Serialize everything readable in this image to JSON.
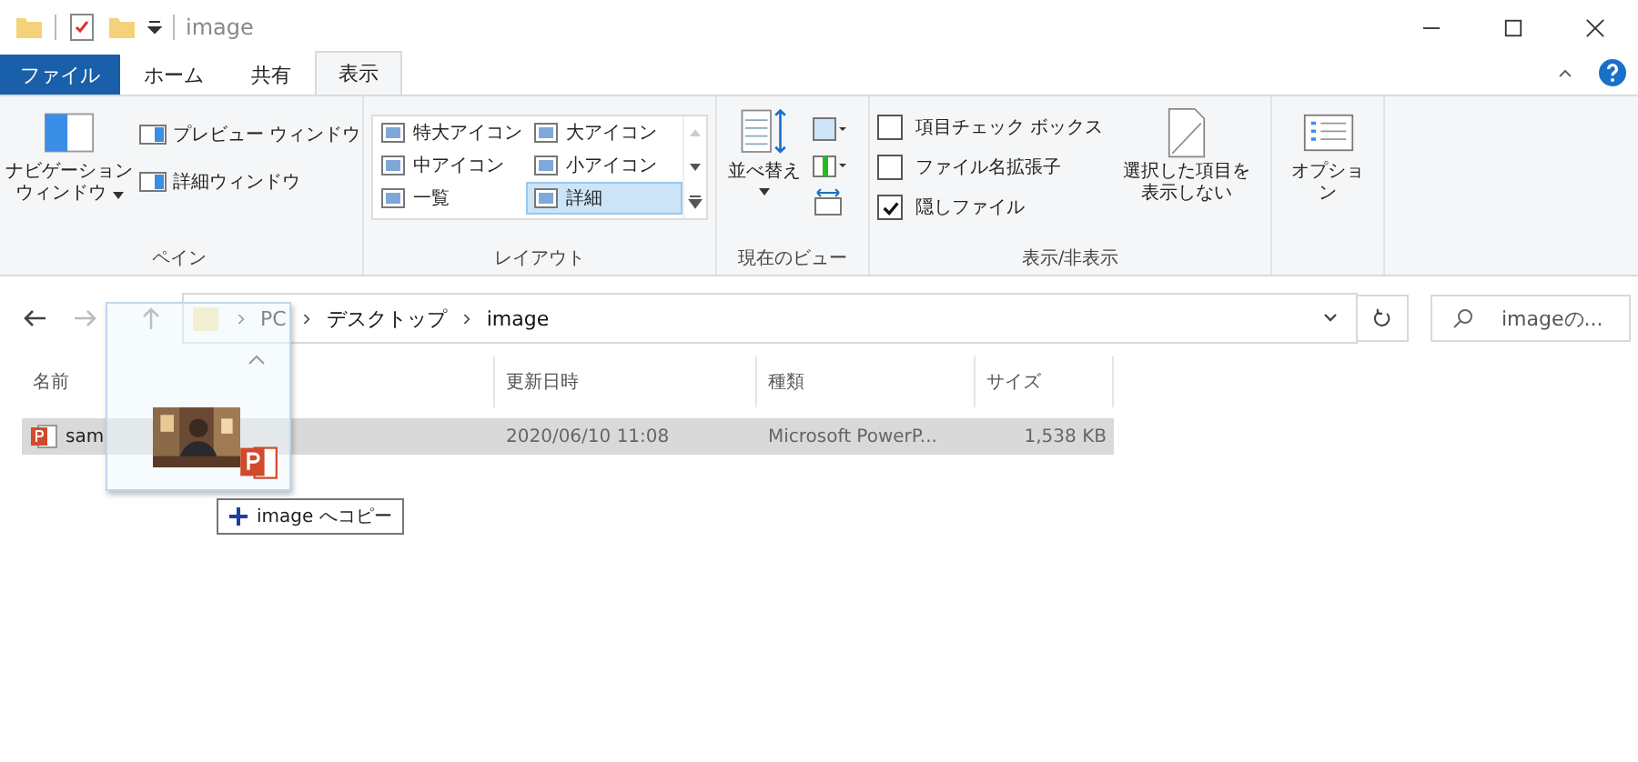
{
  "window": {
    "title": "image"
  },
  "tabs": [
    {
      "label": "ファイル",
      "kind": "file",
      "selected": false
    },
    {
      "label": "ホーム",
      "kind": "tab",
      "selected": false
    },
    {
      "label": "共有",
      "kind": "tab",
      "selected": false
    },
    {
      "label": "表示",
      "kind": "tab",
      "selected": true
    }
  ],
  "ribbon": {
    "pane": {
      "caption": "ペイン",
      "nav_button": [
        "ナビゲーション",
        "ウィンドウ"
      ],
      "items": [
        "プレビュー ウィンドウ",
        "詳細ウィンドウ"
      ]
    },
    "layout": {
      "caption": "レイアウト",
      "items": [
        {
          "label": "特大アイコン",
          "selected": false
        },
        {
          "label": "大アイコン",
          "selected": false
        },
        {
          "label": "中アイコン",
          "selected": false
        },
        {
          "label": "小アイコン",
          "selected": false
        },
        {
          "label": "一覧",
          "selected": false
        },
        {
          "label": "詳細",
          "selected": true
        }
      ]
    },
    "current_view": {
      "caption": "現在のビュー",
      "sort_button": "並べ替え"
    },
    "show_hide": {
      "caption": "表示/非表示",
      "checkboxes": [
        {
          "label": "項目チェック ボックス",
          "checked": false
        },
        {
          "label": "ファイル名拡張子",
          "checked": false
        },
        {
          "label": "隠しファイル",
          "checked": true
        }
      ],
      "hide_button": [
        "選択した項目を",
        "表示しない"
      ]
    },
    "options": {
      "label": "オプション"
    }
  },
  "address": {
    "crumbs": [
      "PC",
      "デスクトップ",
      "image"
    ],
    "search": {
      "placeholder": "imageの..."
    }
  },
  "table": {
    "columns": [
      "名前",
      "更新日時",
      "種類",
      "サイズ"
    ],
    "rows": [
      {
        "cells": [
          "sam",
          "2020/06/10 11:08",
          "Microsoft PowerP...",
          "1,538 KB"
        ],
        "selected": true
      }
    ]
  },
  "drag": {
    "tooltip": "image へコピー"
  }
}
